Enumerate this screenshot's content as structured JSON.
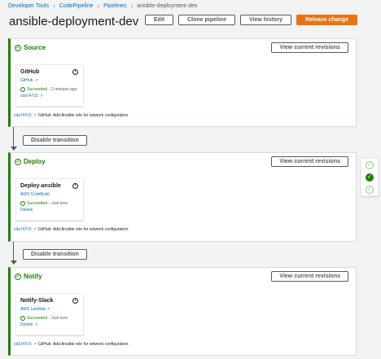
{
  "breadcrumb": [
    "Developer Tools",
    "CodePipeline",
    "Pipelines",
    "ansible-deployment-dev"
  ],
  "title": "ansible-deployment-dev",
  "actions": {
    "edit": "Edit",
    "clone": "Clone pipeline",
    "history": "View history",
    "release": "Release change"
  },
  "view_revisions_label": "View current revisions",
  "disable_transition_label": "Disable transition",
  "stages": [
    {
      "name": "Source",
      "action": {
        "name": "GitHub",
        "provider": "GitHub",
        "status": "Succeeded",
        "time": "- 2 minutes ago",
        "sublink": "cda747c5"
      },
      "commit_hash": "cda747c5",
      "commit_message": "GitHub: Add Ansible role for network configuration."
    },
    {
      "name": "Deploy",
      "action": {
        "name": "Deploy-ansible",
        "provider": "AWS CodeBuild",
        "status": "Succeeded",
        "time": "- Just now",
        "sublink": "Details"
      },
      "commit_hash": "cda747c5",
      "commit_message": "GitHub: Add Ansible role for network configuration."
    },
    {
      "name": "Notify",
      "action": {
        "name": "Notify-Slack",
        "provider": "AWS Lambda",
        "status": "Succeeded",
        "time": "- Just now",
        "sublink": "Details"
      },
      "commit_hash": "cda747c5",
      "commit_message": "GitHub: Add Ansible role for network configuration."
    }
  ],
  "colors": {
    "success": "#1d8102",
    "link": "#0073bb",
    "primary_button": "#ec7211"
  },
  "icons": {
    "stage_status": "check-circle-icon",
    "info": "info-icon",
    "external_link": "external-link-icon"
  }
}
